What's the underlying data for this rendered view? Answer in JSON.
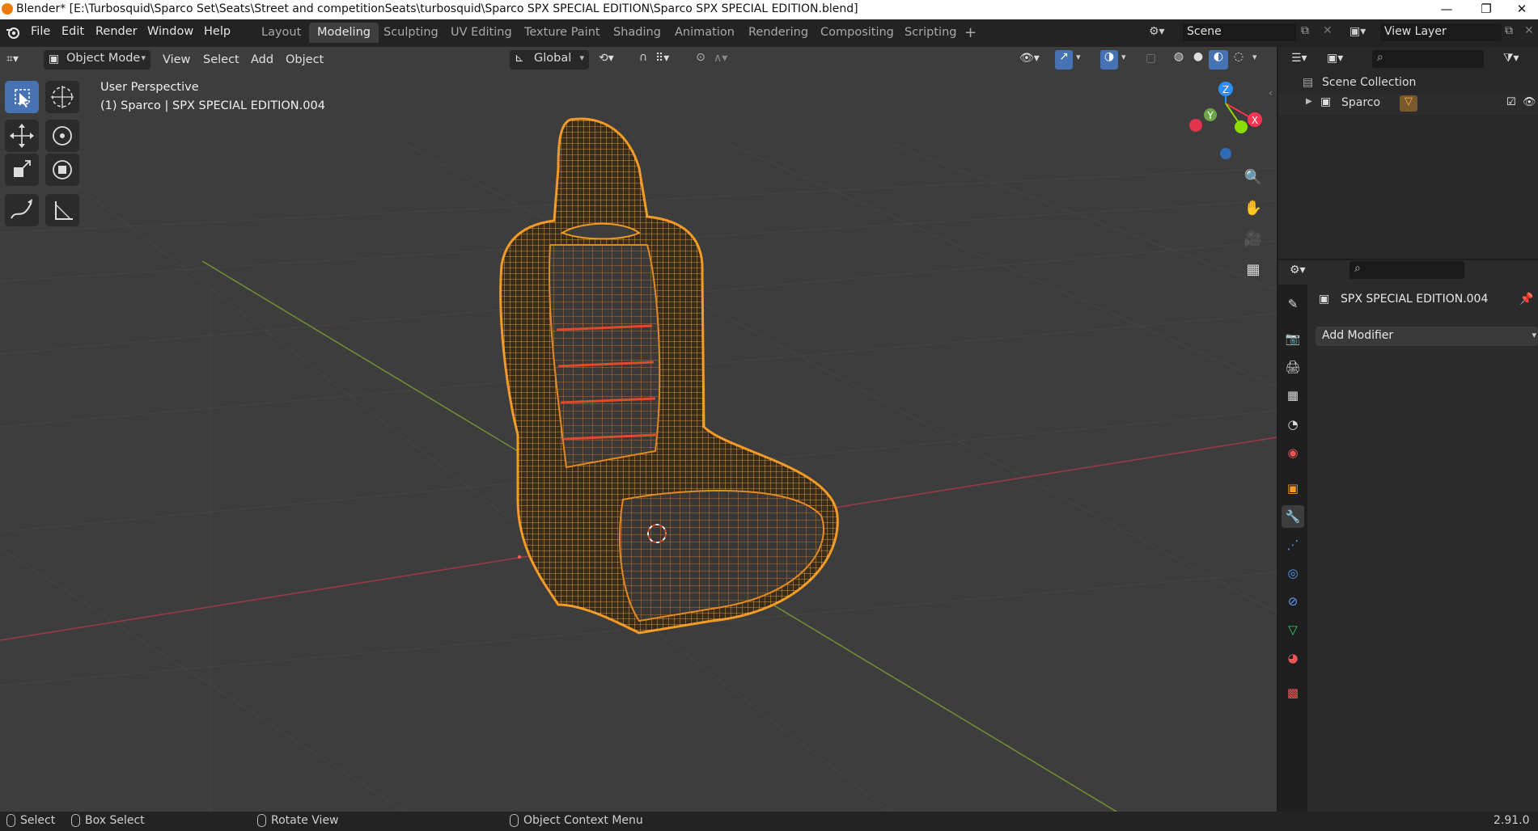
{
  "window": {
    "title": "Blender* [E:\\Turbosquid\\Sparco Set\\Seats\\Street and competitionSeats\\turbosquid\\Sparco SPX SPECIAL EDITION\\Sparco SPX SPECIAL EDITION.blend]",
    "minimize": "—",
    "restore": "❐",
    "close": "✕"
  },
  "menu": {
    "file": "File",
    "edit": "Edit",
    "render": "Render",
    "window": "Window",
    "help": "Help"
  },
  "workspaces": [
    {
      "label": "Layout"
    },
    {
      "label": "Modeling"
    },
    {
      "label": "Sculpting"
    },
    {
      "label": "UV Editing"
    },
    {
      "label": "Texture Paint"
    },
    {
      "label": "Shading"
    },
    {
      "label": "Animation"
    },
    {
      "label": "Rendering"
    },
    {
      "label": "Compositing"
    },
    {
      "label": "Scripting"
    }
  ],
  "active_workspace": "Modeling",
  "scene": {
    "name": "Scene",
    "view_layer": "View Layer"
  },
  "viewport_header": {
    "mode": "Object Mode",
    "view": "View",
    "select": "Select",
    "add": "Add",
    "object": "Object",
    "orientation": "Global"
  },
  "viewport": {
    "perspective": "User Perspective",
    "active_object": "(1) Sparco | SPX SPECIAL EDITION.004",
    "gizmo": {
      "z": "Z",
      "y": "Y",
      "x": "X"
    }
  },
  "outliner": {
    "root": "Scene Collection",
    "items": [
      {
        "label": "Sparco"
      }
    ]
  },
  "properties": {
    "object_name": "SPX SPECIAL EDITION.004",
    "add_modifier": "Add Modifier"
  },
  "statusbar": {
    "select": "Select",
    "box_select": "Box Select",
    "rotate_view": "Rotate View",
    "context_menu": "Object Context Menu",
    "version": "2.91.0"
  },
  "colors": {
    "selection_orange": "#f39a24",
    "active_blue": "#4772b3",
    "axis_red": "#ff3352",
    "axis_green": "#8bdc00",
    "axis_blue": "#2890ff"
  }
}
